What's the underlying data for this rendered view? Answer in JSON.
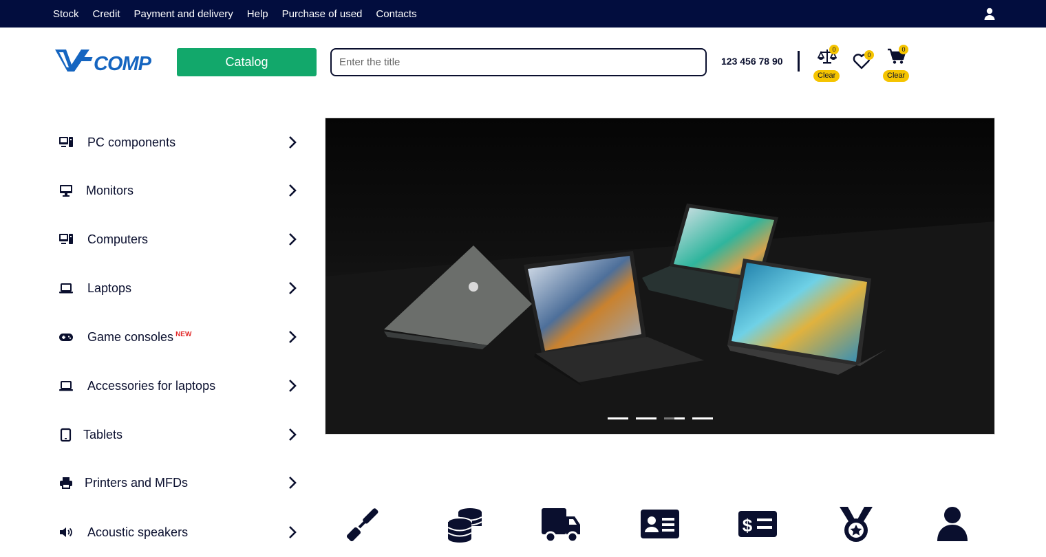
{
  "topnav": {
    "items": [
      "Stock",
      "Credit",
      "Payment and delivery",
      "Help",
      "Purchase of used",
      "Contacts"
    ]
  },
  "header": {
    "logo_text": "V-COMP",
    "catalog_label": "Catalog",
    "search_placeholder": "Enter the title",
    "phone": "123 456 78 90",
    "compare": {
      "count": "0",
      "clear_label": "Clear"
    },
    "favorites": {
      "count": "0"
    },
    "cart": {
      "count": "0",
      "clear_label": "Clear"
    }
  },
  "categories": [
    {
      "label": "PC components",
      "icon": "pc-icon",
      "new": ""
    },
    {
      "label": "Monitors",
      "icon": "monitor-icon",
      "new": ""
    },
    {
      "label": "Computers",
      "icon": "pc-icon",
      "new": ""
    },
    {
      "label": "Laptops",
      "icon": "laptop-icon",
      "new": ""
    },
    {
      "label": "Game consoles",
      "icon": "gamepad-icon",
      "new": "NEW"
    },
    {
      "label": "Accessories for laptops",
      "icon": "laptop-icon",
      "new": ""
    },
    {
      "label": "Tablets",
      "icon": "tablet-icon",
      "new": ""
    },
    {
      "label": "Printers and MFDs",
      "icon": "printer-icon",
      "new": ""
    },
    {
      "label": "Acoustic speakers",
      "icon": "speaker-icon",
      "new": ""
    }
  ],
  "banner": {
    "slides": 4,
    "active_slide": 3
  },
  "features": [
    "screwdriver-icon",
    "coins-icon",
    "truck-icon",
    "id-card-icon",
    "money-bill-icon",
    "medal-icon",
    "user-icon"
  ],
  "colors": {
    "navy": "#020d3e",
    "green": "#12a86b",
    "yellow": "#f5c400",
    "logo_blue": "#1565c0"
  }
}
